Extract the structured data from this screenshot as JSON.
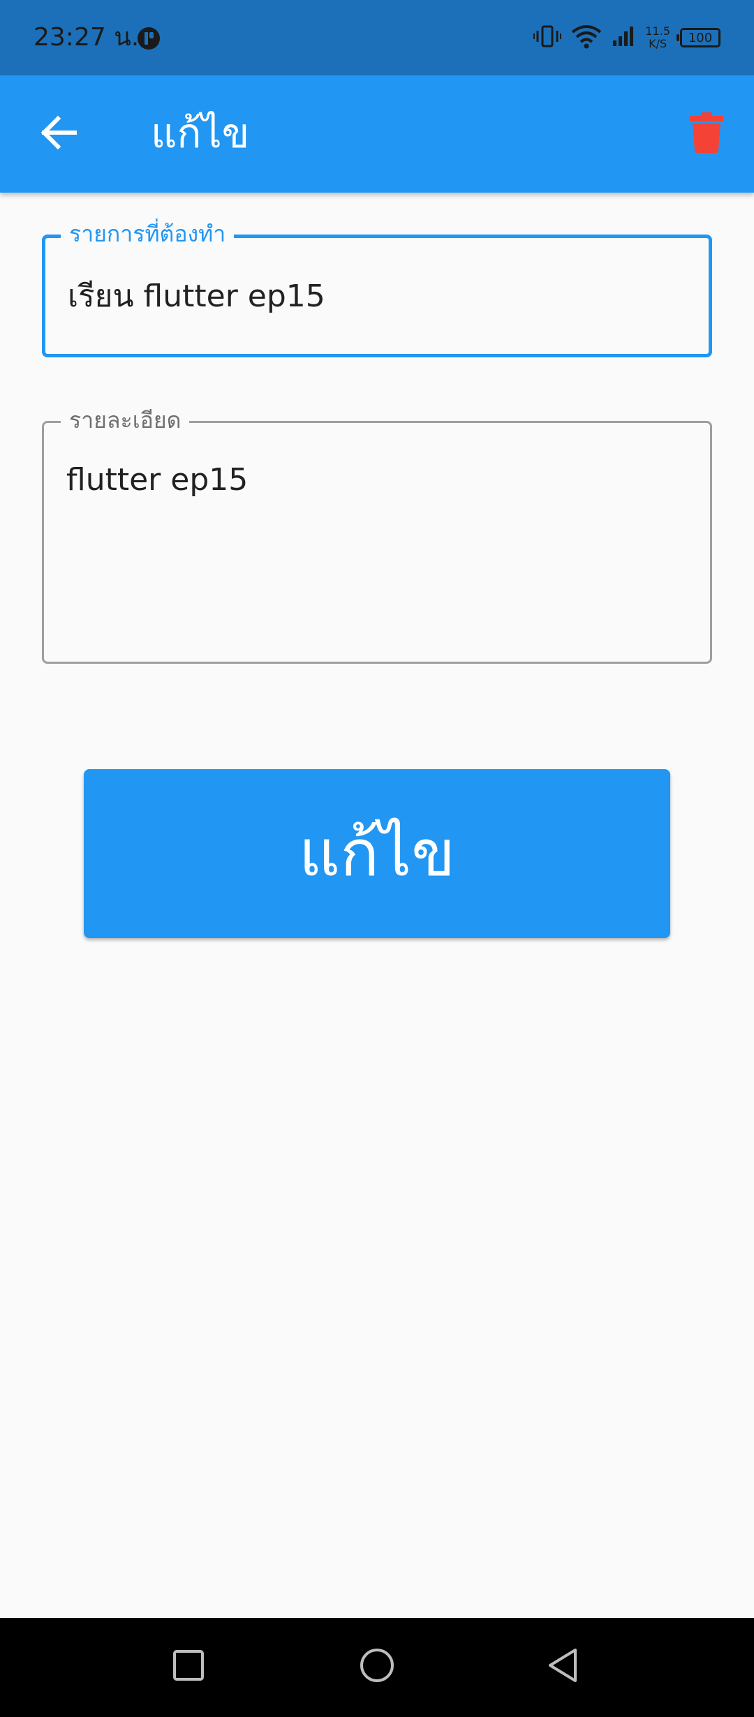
{
  "status_bar": {
    "time": "23:27 น.",
    "net_speed_value": "11.5",
    "net_speed_unit": "K/S",
    "battery": "100",
    "icons": [
      "app-notification-icon",
      "vibrate-icon",
      "wifi-icon",
      "signal-icon",
      "battery-icon"
    ]
  },
  "app_bar": {
    "title": "แก้ไข",
    "back_icon": "arrow-back-icon",
    "delete_icon": "trash-icon"
  },
  "form": {
    "title_field": {
      "label": "รายการที่ต้องทำ",
      "value": "เรียน flutter ep15"
    },
    "detail_field": {
      "label": "รายละเอียด",
      "value": "flutter ep15"
    },
    "submit_label": "แก้ไข"
  },
  "nav_bar": {
    "icons": [
      "recents-icon",
      "home-icon",
      "back-triangle-icon"
    ]
  },
  "colors": {
    "primary": "#2196f3",
    "status_bar": "#1c70b9",
    "delete": "#f44336",
    "background": "#fafafa"
  }
}
